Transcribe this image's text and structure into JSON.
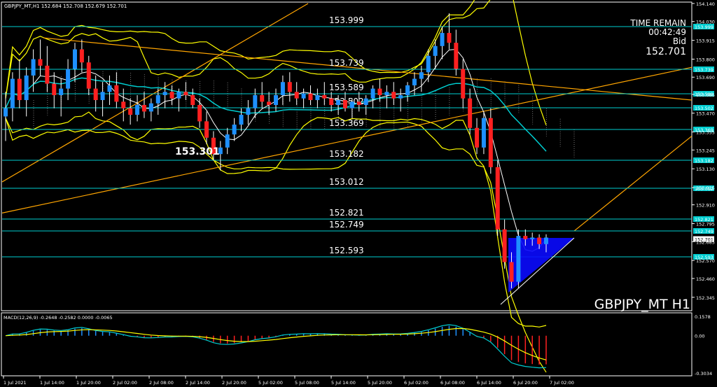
{
  "header": {
    "info": "GBPJPY_MT,H1  152.684 152.708 152.679 152.701"
  },
  "overlay": {
    "time_remain_label": "TIME REMAIN",
    "time_remain_value": "00:42:49",
    "bid_label": "Bid",
    "bid_value": "152.701",
    "watermark": "GBPJPY_MT H1",
    "low_marker": "153.301"
  },
  "colors": {
    "background": "#000000",
    "bull_candle": "#1E90FF",
    "bear_candle": "#FF2020",
    "level_line": "#00CED1",
    "bollinger": "#FFFF00",
    "trendline": "#FFA500",
    "ma_fast": "#FFFFFF",
    "ma_cyan": "#00CED1",
    "triangle": "#0000FF",
    "macd_signal": "#FFFF00",
    "macd_main": "#00CED1"
  },
  "chart_data": [
    {
      "type": "line",
      "title": "GBPJPY_MT,H1",
      "price_axis": {
        "range": [
          152.28,
          154.14
        ],
        "ticks": [
          "154.140",
          "154.030",
          "153.915",
          "153.800",
          "153.690",
          "153.585",
          "153.470",
          "153.355",
          "153.245",
          "153.130",
          "153.015",
          "152.910",
          "152.795",
          "152.685",
          "152.570",
          "152.460",
          "152.345"
        ]
      },
      "time_axis": {
        "labels": [
          "1 Jul 2021",
          "1 Jul 14:00",
          "1 Jul 20:00",
          "2 Jul 02:00",
          "2 Jul 08:00",
          "2 Jul 14:00",
          "2 Jul 20:00",
          "5 Jul 02:00",
          "5 Jul 08:00",
          "5 Jul 14:00",
          "5 Jul 20:00",
          "6 Jul 02:00",
          "6 Jul 08:00",
          "6 Jul 14:00",
          "6 Jul 20:00",
          "7 Jul 02:00"
        ]
      },
      "levels": [
        {
          "value": "153.999",
          "label": "153.999",
          "tag": "153.999"
        },
        {
          "value": "153.739",
          "label": "153.739",
          "tag": "153.739"
        },
        {
          "value": "153.589",
          "label": "153.589",
          "tag": "153.589"
        },
        {
          "value": "153.502",
          "label": "153.502",
          "tag": "153.502"
        },
        {
          "value": "153.369",
          "label": "153.369",
          "tag": "153.369"
        },
        {
          "value": "153.182",
          "label": "153.182",
          "tag": "153.182"
        },
        {
          "value": "153.012",
          "label": "153.012",
          "tag": "153.012"
        },
        {
          "value": "152.821",
          "label": "152.821",
          "tag": "152.821"
        },
        {
          "value": "152.749",
          "label": "152.749",
          "tag": "152.749"
        },
        {
          "value": "152.593",
          "label": "152.593",
          "tag": "152.593"
        }
      ],
      "current_price": "152.701",
      "candles_ohlc": [
        [
          153.45,
          153.6,
          153.3,
          153.5
        ],
        [
          153.5,
          153.72,
          153.42,
          153.68
        ],
        [
          153.68,
          153.8,
          153.5,
          153.55
        ],
        [
          153.55,
          153.75,
          153.45,
          153.7
        ],
        [
          153.7,
          153.86,
          153.6,
          153.8
        ],
        [
          153.8,
          153.92,
          153.7,
          153.76
        ],
        [
          153.76,
          153.88,
          153.6,
          153.65
        ],
        [
          153.65,
          153.72,
          153.5,
          153.58
        ],
        [
          153.58,
          153.68,
          153.45,
          153.62
        ],
        [
          153.62,
          153.8,
          153.55,
          153.74
        ],
        [
          153.74,
          153.9,
          153.66,
          153.86
        ],
        [
          153.86,
          153.92,
          153.72,
          153.78
        ],
        [
          153.78,
          153.82,
          153.58,
          153.62
        ],
        [
          153.62,
          153.7,
          153.48,
          153.55
        ],
        [
          153.55,
          153.66,
          153.45,
          153.6
        ],
        [
          153.6,
          153.7,
          153.52,
          153.64
        ],
        [
          153.64,
          153.72,
          153.5,
          153.54
        ],
        [
          153.54,
          153.62,
          153.42,
          153.5
        ],
        [
          153.5,
          153.56,
          153.4,
          153.46
        ],
        [
          153.46,
          153.58,
          153.42,
          153.52
        ],
        [
          153.52,
          153.6,
          153.44,
          153.48
        ],
        [
          153.48,
          153.56,
          153.42,
          153.53
        ],
        [
          153.53,
          153.62,
          153.46,
          153.58
        ],
        [
          153.58,
          153.66,
          153.5,
          153.6
        ],
        [
          153.6,
          153.64,
          153.52,
          153.56
        ],
        [
          153.56,
          153.62,
          153.48,
          153.6
        ],
        [
          153.6,
          153.66,
          153.55,
          153.58
        ],
        [
          153.58,
          153.62,
          153.5,
          153.52
        ],
        [
          153.52,
          153.56,
          153.38,
          153.42
        ],
        [
          153.42,
          153.48,
          153.28,
          153.32
        ],
        [
          153.32,
          153.36,
          153.18,
          153.22
        ],
        [
          153.22,
          153.3,
          153.12,
          153.26
        ],
        [
          153.26,
          153.38,
          153.22,
          153.34
        ],
        [
          153.34,
          153.44,
          153.3,
          153.4
        ],
        [
          153.4,
          153.5,
          153.36,
          153.46
        ],
        [
          153.46,
          153.55,
          153.4,
          153.5
        ],
        [
          153.5,
          153.62,
          153.44,
          153.58
        ],
        [
          153.58,
          153.66,
          153.5,
          153.54
        ],
        [
          153.54,
          153.6,
          153.46,
          153.52
        ],
        [
          153.52,
          153.62,
          153.48,
          153.58
        ],
        [
          153.58,
          153.7,
          153.52,
          153.66
        ],
        [
          153.66,
          153.72,
          153.54,
          153.6
        ],
        [
          153.6,
          153.66,
          153.52,
          153.56
        ],
        [
          153.56,
          153.62,
          153.5,
          153.59
        ],
        [
          153.59,
          153.64,
          153.52,
          153.55
        ],
        [
          153.55,
          153.62,
          153.5,
          153.58
        ],
        [
          153.58,
          153.66,
          153.52,
          153.56
        ],
        [
          153.56,
          153.6,
          153.48,
          153.52
        ],
        [
          153.52,
          153.58,
          153.46,
          153.55
        ],
        [
          153.55,
          153.6,
          153.48,
          153.5
        ],
        [
          153.5,
          153.56,
          153.44,
          153.54
        ],
        [
          153.54,
          153.6,
          153.48,
          153.52
        ],
        [
          153.52,
          153.58,
          153.46,
          153.56
        ],
        [
          153.56,
          153.64,
          153.5,
          153.62
        ],
        [
          153.62,
          153.68,
          153.54,
          153.58
        ],
        [
          153.58,
          153.64,
          153.5,
          153.6
        ],
        [
          153.6,
          153.66,
          153.52,
          153.56
        ],
        [
          153.56,
          153.62,
          153.48,
          153.58
        ],
        [
          153.58,
          153.66,
          153.54,
          153.64
        ],
        [
          153.64,
          153.72,
          153.58,
          153.68
        ],
        [
          153.68,
          153.76,
          153.6,
          153.72
        ],
        [
          153.72,
          153.86,
          153.66,
          153.82
        ],
        [
          153.82,
          153.92,
          153.74,
          153.88
        ],
        [
          153.88,
          154.0,
          153.8,
          153.96
        ],
        [
          153.96,
          154.08,
          153.86,
          153.9
        ],
        [
          153.9,
          153.98,
          153.7,
          153.74
        ],
        [
          153.74,
          153.8,
          153.5,
          153.56
        ],
        [
          153.56,
          153.62,
          153.34,
          153.38
        ],
        [
          153.38,
          153.44,
          153.22,
          153.26
        ],
        [
          153.26,
          153.48,
          153.22,
          153.44
        ],
        [
          153.44,
          153.5,
          153.1,
          153.14
        ],
        [
          153.14,
          153.18,
          152.72,
          152.76
        ],
        [
          152.76,
          152.82,
          152.52,
          152.56
        ],
        [
          152.56,
          152.62,
          152.4,
          152.44
        ],
        [
          152.44,
          152.76,
          152.4,
          152.72
        ],
        [
          152.72,
          152.76,
          152.66,
          152.7
        ],
        [
          152.7,
          152.74,
          152.66,
          152.71
        ],
        [
          152.71,
          152.73,
          152.64,
          152.67
        ],
        [
          152.67,
          152.73,
          152.62,
          152.71
        ]
      ],
      "annotation": "153.301"
    },
    {
      "type": "bar",
      "title": "MACD(12,26,9) -0.2648 -0.2582 0.0000 -0.0065",
      "axis_ticks": [
        "0.1578",
        "0.00",
        "-0.3034"
      ],
      "range": [
        -0.3034,
        0.1578
      ]
    }
  ]
}
